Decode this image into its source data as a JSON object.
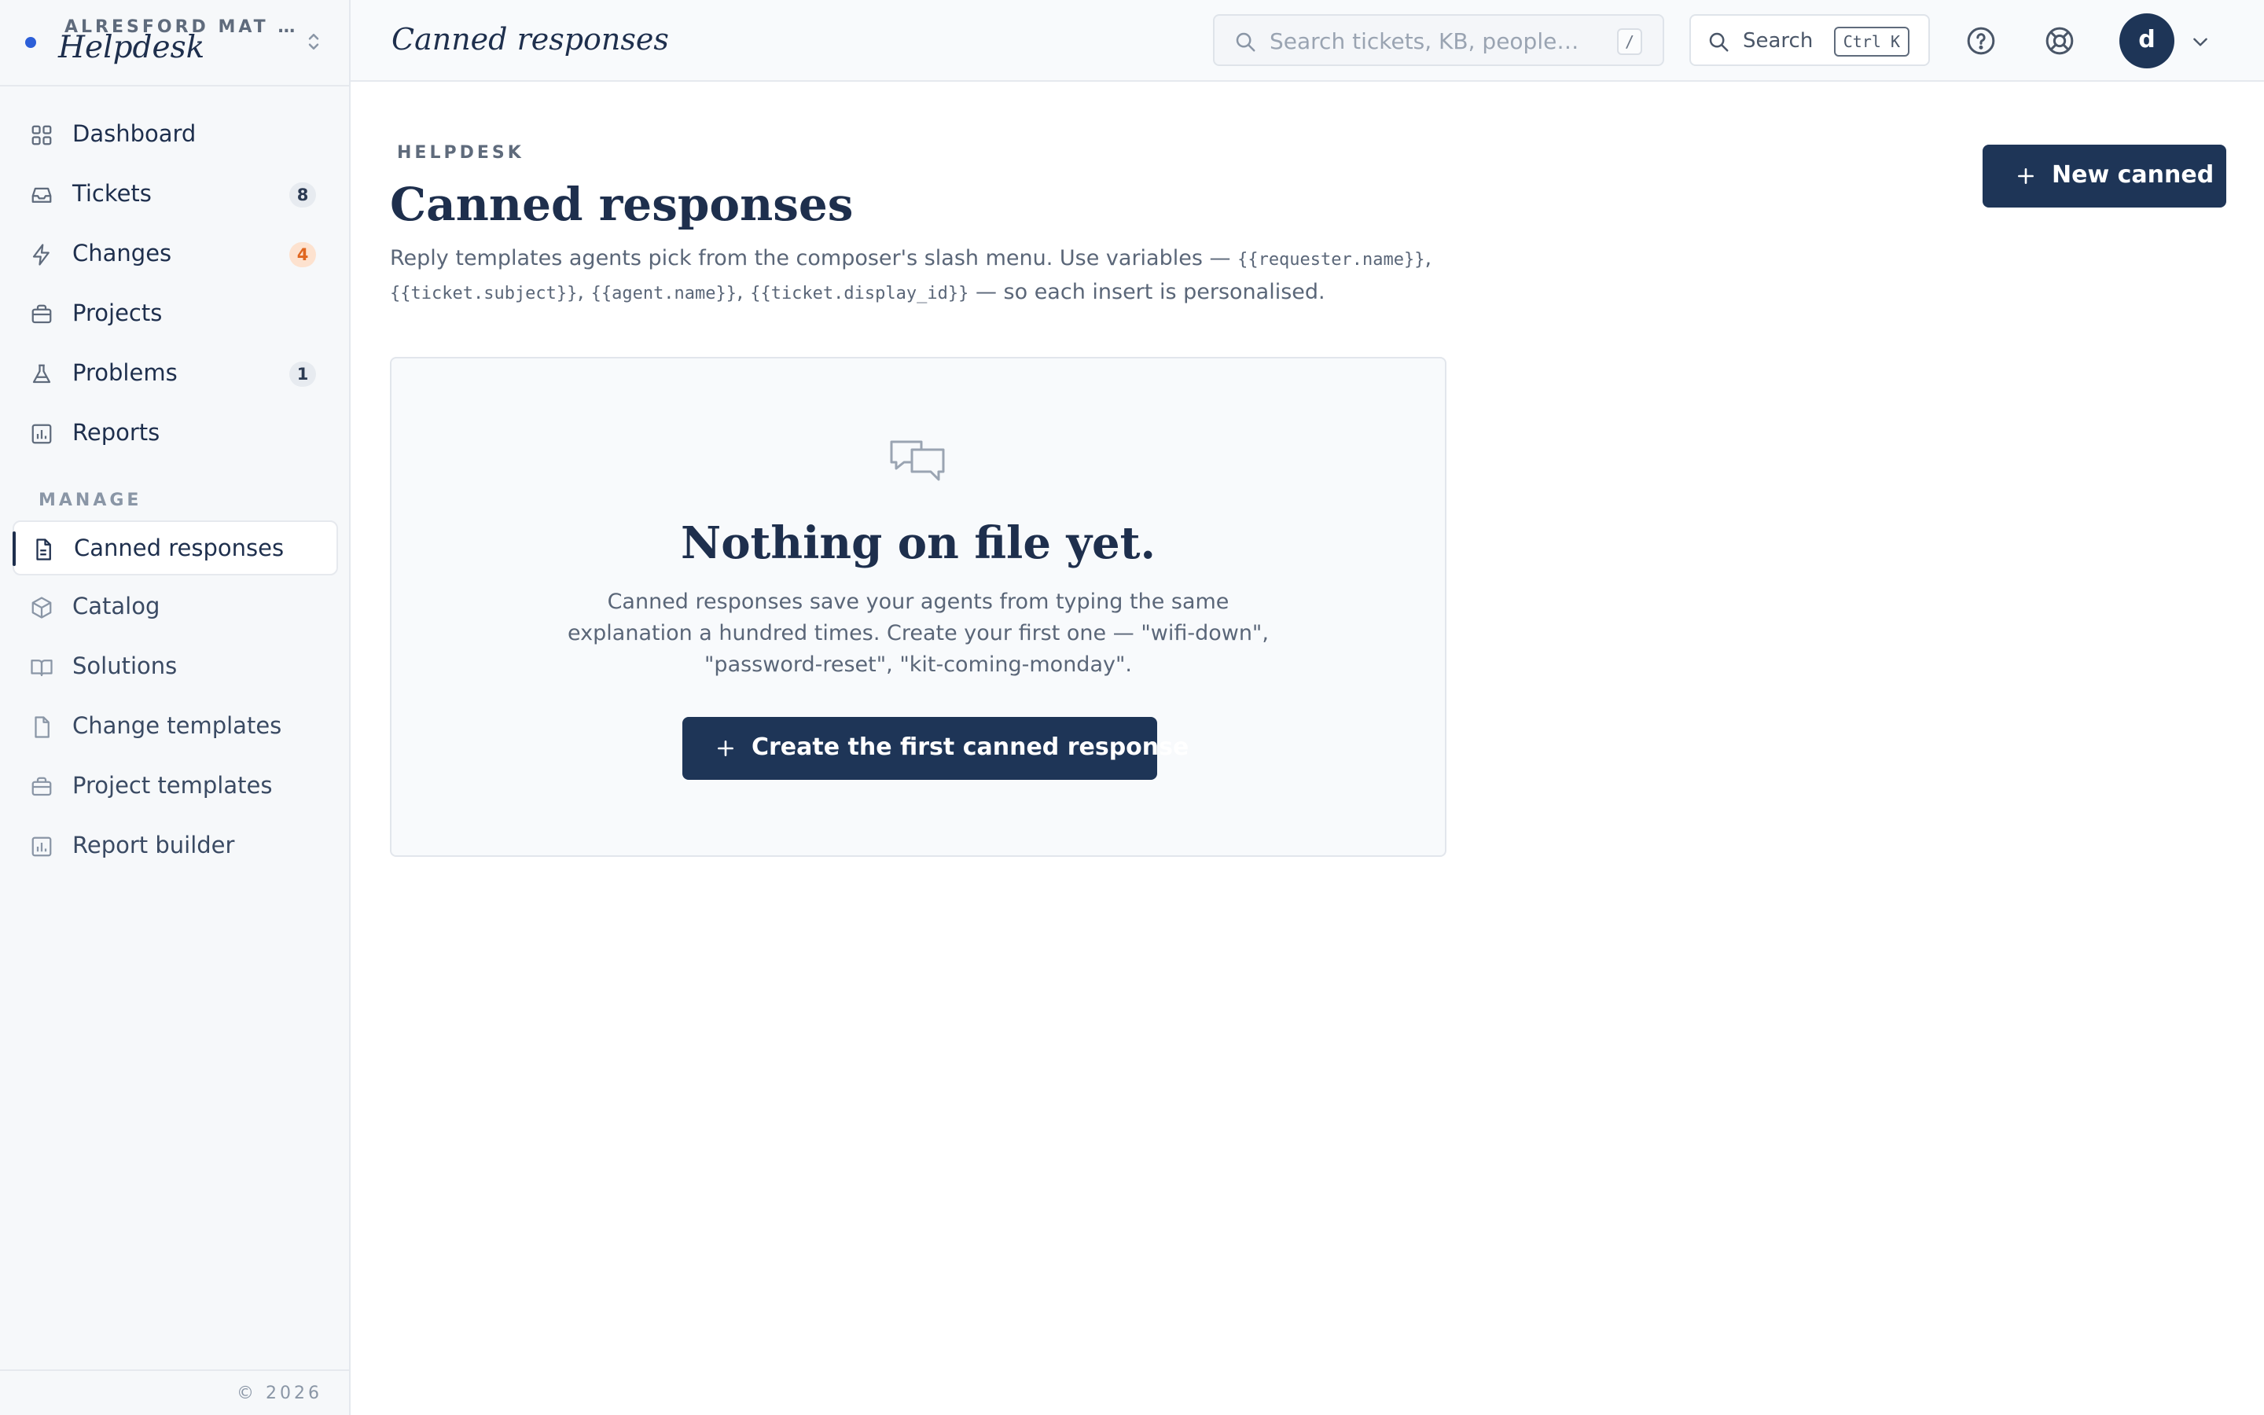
{
  "workspace": {
    "org": "ALRESFORD MAT …",
    "name": "Helpdesk"
  },
  "nav": {
    "main": [
      {
        "label": "Dashboard",
        "icon": "grid-icon"
      },
      {
        "label": "Tickets",
        "icon": "inbox-icon",
        "badge": "8"
      },
      {
        "label": "Changes",
        "icon": "lightning-icon",
        "badge": "4"
      },
      {
        "label": "Projects",
        "icon": "briefcase-icon"
      },
      {
        "label": "Problems",
        "icon": "flask-icon",
        "badge": "1"
      },
      {
        "label": "Reports",
        "icon": "bar-chart-icon"
      }
    ],
    "section_label": "MANAGE",
    "manage": [
      {
        "label": "Canned responses",
        "icon": "document-icon",
        "active": true
      },
      {
        "label": "Catalog",
        "icon": "cube-icon"
      },
      {
        "label": "Solutions",
        "icon": "book-icon"
      },
      {
        "label": "Change templates",
        "icon": "document-icon"
      },
      {
        "label": "Project templates",
        "icon": "briefcase-icon"
      },
      {
        "label": "Report builder",
        "icon": "bar-chart-icon"
      }
    ],
    "copyright": "© 2026"
  },
  "topbar": {
    "title": "Canned responses",
    "search_placeholder": "Search tickets, KB, people…",
    "search_shortcut": "/",
    "search_button_label": "Search",
    "search_button_shortcut": "Ctrl K",
    "avatar_initial": "d"
  },
  "page": {
    "eyebrow": "HELPDESK",
    "title": "Canned responses",
    "description_pre": "Reply templates agents pick from the composer's slash menu. Use variables — ",
    "var1": "{{requester.name}}",
    "sep1": ", ",
    "var2": "{{ticket.subject}}",
    "sep2": ", ",
    "var3": "{{agent.name}}",
    "sep3": ", ",
    "var4": "{{ticket.display_id}}",
    "description_post": " — so each insert is personalised.",
    "new_button": "New canned"
  },
  "empty_state": {
    "title": "Nothing on file yet.",
    "body": "Canned responses save your agents from typing the same explanation a hundred times. Create your first one — \"wifi-down\", \"password-reset\", \"kit-coming-monday\".",
    "button": "Create the first canned response"
  },
  "colors": {
    "accent": "#1e3557",
    "active_dot": "#2c5fd8",
    "badge_orange": "#e0661f"
  }
}
